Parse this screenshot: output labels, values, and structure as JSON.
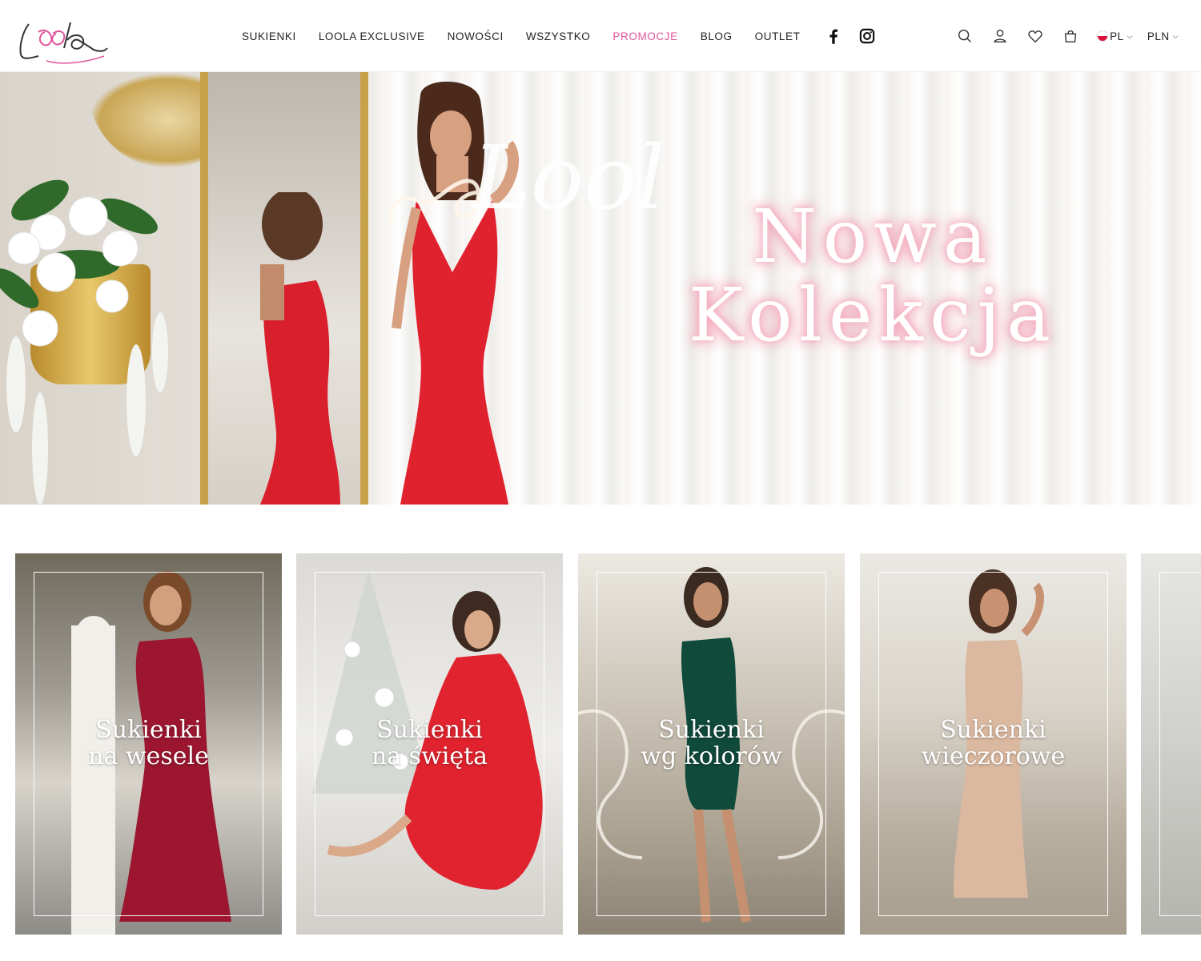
{
  "header": {
    "logo_text": "Loola",
    "nav": [
      {
        "label": "SUKIENKI"
      },
      {
        "label": "LOOLA EXCLUSIVE"
      },
      {
        "label": "NOWOŚCI"
      },
      {
        "label": "WSZYSTKO"
      },
      {
        "label": "PROMOCJE"
      },
      {
        "label": "BLOG"
      },
      {
        "label": "OUTLET"
      }
    ],
    "social": [
      "facebook-icon",
      "instagram-icon"
    ],
    "tools": [
      "search-icon",
      "user-icon",
      "heart-icon",
      "bag-icon"
    ],
    "language": "PL",
    "currency": "PLN"
  },
  "hero": {
    "title_line1": "Nowa",
    "title_line2": "Kolekcja",
    "sign_text": "Loola"
  },
  "tiles": [
    {
      "line1": "Sukienki",
      "line2": "na wesele",
      "color": "#a3182f"
    },
    {
      "line1": "Sukienki",
      "line2": "na święta",
      "color": "#d92630"
    },
    {
      "line1": "Sukienki",
      "line2": "wg kolorów",
      "color": "#0f4a3a"
    },
    {
      "line1": "Sukienki",
      "line2": "wieczorowe",
      "color": "#d8b59b"
    }
  ],
  "colors": {
    "accent_pink": "#e0559a",
    "text": "#222222",
    "red_dress": "#e0222f"
  }
}
